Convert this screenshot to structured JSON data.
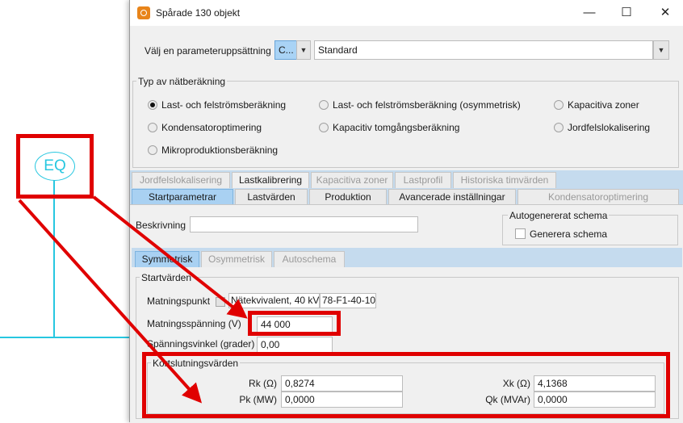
{
  "background": {
    "symbol_label": "EQ"
  },
  "window": {
    "title": "Spårade 130 objekt",
    "controls": {
      "minimize": "—",
      "maximize": "☐",
      "close": "✕"
    }
  },
  "param_set": {
    "label": "Välj en parameteruppsättning",
    "button_label": "C...",
    "value": "Standard"
  },
  "calc_type": {
    "title": "Typ av nätberäkning",
    "options": [
      {
        "label": "Last- och felströmsberäkning",
        "selected": true
      },
      {
        "label": "Last- och felströmsberäkning (osymmetrisk)",
        "selected": false
      },
      {
        "label": "Kapacitiva zoner",
        "selected": false
      },
      {
        "label": "Kondensatoroptimering",
        "selected": false
      },
      {
        "label": "Kapacitiv tomgångsberäkning",
        "selected": false
      },
      {
        "label": "Jordfelslokalisering",
        "selected": false
      },
      {
        "label": "Mikroproduktionsberäkning",
        "selected": false
      }
    ]
  },
  "tabs_row1": [
    "Jordfelslokalisering",
    "Lastkalibrering",
    "Kapacitiva zoner",
    "Lastprofil",
    "Historiska timvärden"
  ],
  "tabs_row2": [
    "Startparametrar",
    "Lastvärden",
    "Produktion",
    "Avancerade inställningar",
    "Kondensatoroptimering"
  ],
  "description": {
    "label": "Beskrivning",
    "value": ""
  },
  "autoschema": {
    "title": "Autogenererat schema",
    "checkbox_label": "Generera schema",
    "checked": false
  },
  "subtabs": [
    "Symmetrisk",
    "Osymmetrisk",
    "Autoschema"
  ],
  "start_values": {
    "title": "Startvärden",
    "feed_point_label": "Matningspunkt",
    "feed_point_name": "Nätekvivalent, 40 kV",
    "feed_point_id": "78-F1-40-10",
    "voltage_label": "Matningsspänning (V)",
    "voltage_value": "44 000",
    "angle_label": "Spänningsvinkel (grader)",
    "angle_value": "0,00"
  },
  "short_circuit": {
    "title": "Kortslutningsvärden",
    "rk_label": "Rk (Ω)",
    "rk_value": "0,8274",
    "xk_label": "Xk (Ω)",
    "xk_value": "4,1368",
    "pk_label": "Pk (MW)",
    "pk_value": "0,0000",
    "qk_label": "Qk (MVAr)",
    "qk_value": "0,0000"
  },
  "colors": {
    "annotation_red": "#e00000",
    "line_cyan": "#27c7e0",
    "selected_blue": "#a9d1f2"
  }
}
